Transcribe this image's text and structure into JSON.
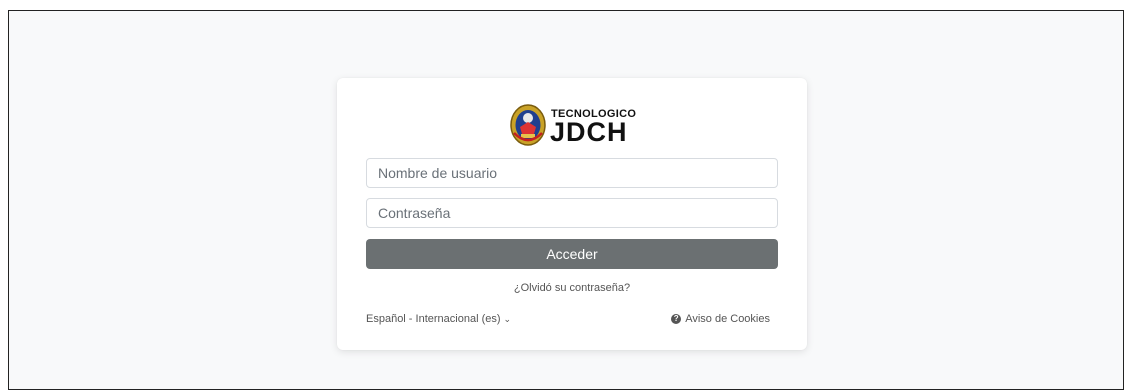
{
  "logo": {
    "line1": "TECNOLOGICO",
    "line2": "JDCH"
  },
  "login": {
    "username_placeholder": "Nombre de usuario",
    "username_value": "",
    "password_placeholder": "Contraseña",
    "password_value": "",
    "submit_label": "Acceder",
    "forgot_label": "¿Olvidó su contraseña?"
  },
  "footer": {
    "language_label": "Español - Internacional (es)",
    "language_chevron": "⌄",
    "cookies_icon": "question-circle-icon",
    "cookies_icon_glyph": "?",
    "cookies_label": "Aviso de Cookies"
  },
  "colors": {
    "page_bg": "#f8f9fa",
    "card_bg": "#ffffff",
    "button_bg": "#6b7072",
    "text_muted": "#555555"
  }
}
